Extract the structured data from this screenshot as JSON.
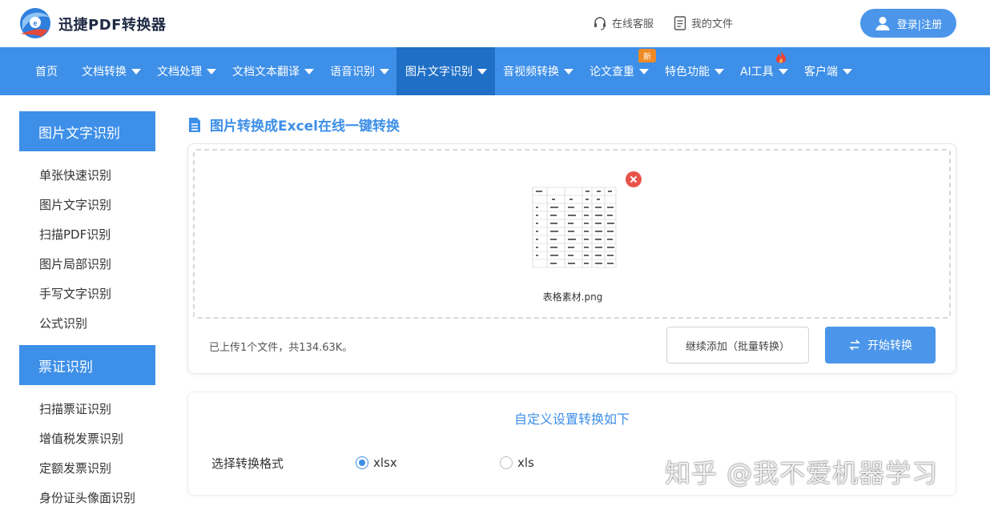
{
  "header": {
    "brand": "迅捷PDF转换器",
    "service_label": "在线客服",
    "files_label": "我的文件",
    "login_label": "登录|注册"
  },
  "nav": {
    "items": [
      {
        "label": "首页"
      },
      {
        "label": "文档转换"
      },
      {
        "label": "文档处理"
      },
      {
        "label": "文档文本翻译"
      },
      {
        "label": "语音识别"
      },
      {
        "label": "图片文字识别"
      },
      {
        "label": "音视频转换"
      },
      {
        "label": "论文查重"
      },
      {
        "label": "特色功能"
      },
      {
        "label": "AI工具"
      },
      {
        "label": "客户端"
      }
    ],
    "active_index": 5,
    "badge_new": "新"
  },
  "sidebar": {
    "group1_title": "图片文字识别",
    "group1_items": [
      "单张快速识别",
      "图片文字识别",
      "扫描PDF识别",
      "图片局部识别",
      "手写文字识别",
      "公式识别"
    ],
    "group2_title": "票证识别",
    "group2_items": [
      "扫描票证识别",
      "增值税发票识别",
      "定额发票识别",
      "身份证头像面识别"
    ]
  },
  "main": {
    "title": "图片转换成Excel在线一键转换",
    "file_name": "表格素材.png",
    "upload_info": "已上传1个文件，共134.63K。",
    "add_button": "继续添加（批量转换）",
    "start_button": "开始转换"
  },
  "settings": {
    "title": "自定义设置转换如下",
    "format_label": "选择转换格式",
    "options": [
      {
        "label": "xlsx",
        "selected": true
      },
      {
        "label": "xls",
        "selected": false
      }
    ]
  },
  "watermark": "知乎 @我不爱机器学习",
  "colors": {
    "accent": "#3d8fe8",
    "nav_active": "#1f6fc6",
    "remove": "#e9534a",
    "badge": "#f08a24"
  }
}
